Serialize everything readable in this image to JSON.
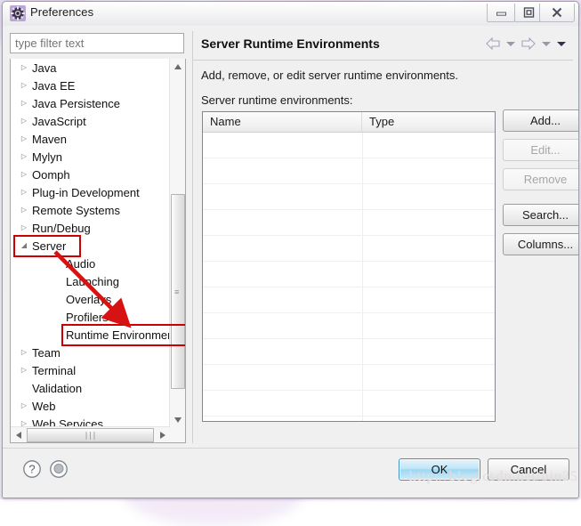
{
  "window": {
    "title": "Preferences",
    "icon": "gear-icon",
    "controls": {
      "minimize": "minimize-icon",
      "maximize": "maximize-icon",
      "close": "close-icon"
    }
  },
  "filter": {
    "value": "",
    "placeholder": "type filter text"
  },
  "tree": {
    "items": [
      {
        "label": "Java",
        "twisty": "▷",
        "level": 0,
        "expanded": false
      },
      {
        "label": "Java EE",
        "twisty": "▷",
        "level": 0,
        "expanded": false
      },
      {
        "label": "Java Persistence",
        "twisty": "▷",
        "level": 0,
        "expanded": false
      },
      {
        "label": "JavaScript",
        "twisty": "▷",
        "level": 0,
        "expanded": false
      },
      {
        "label": "Maven",
        "twisty": "▷",
        "level": 0,
        "expanded": false
      },
      {
        "label": "Mylyn",
        "twisty": "▷",
        "level": 0,
        "expanded": false
      },
      {
        "label": "Oomph",
        "twisty": "▷",
        "level": 0,
        "expanded": false
      },
      {
        "label": "Plug-in Development",
        "twisty": "▷",
        "level": 0,
        "expanded": false
      },
      {
        "label": "Remote Systems",
        "twisty": "▷",
        "level": 0,
        "expanded": false
      },
      {
        "label": "Run/Debug",
        "twisty": "▷",
        "level": 0,
        "expanded": false
      },
      {
        "label": "Server",
        "twisty": "◢",
        "level": 0,
        "expanded": true
      },
      {
        "label": "Audio",
        "twisty": "",
        "level": 1,
        "expanded": false
      },
      {
        "label": "Launching",
        "twisty": "",
        "level": 1,
        "expanded": false
      },
      {
        "label": "Overlays",
        "twisty": "",
        "level": 1,
        "expanded": false
      },
      {
        "label": "Profilers",
        "twisty": "",
        "level": 1,
        "expanded": false
      },
      {
        "label": "Runtime Environment",
        "twisty": "",
        "level": 1,
        "expanded": false
      },
      {
        "label": "Team",
        "twisty": "▷",
        "level": 0,
        "expanded": false
      },
      {
        "label": "Terminal",
        "twisty": "▷",
        "level": 0,
        "expanded": false
      },
      {
        "label": "Validation",
        "twisty": "",
        "level": 0,
        "expanded": false
      },
      {
        "label": "Web",
        "twisty": "▷",
        "level": 0,
        "expanded": false
      },
      {
        "label": "Web Services",
        "twisty": "▷",
        "level": 0,
        "expanded": false
      }
    ],
    "scroll_grip": "≡",
    "hscroll_grip": "∣∣∣",
    "arrow_up": "▲",
    "arrow_down": "▼",
    "arrow_left": "◀",
    "arrow_right": "▶"
  },
  "annotations": {
    "highlight_color": "#cc0000",
    "boxed_items": [
      "Server",
      "Runtime Environment"
    ],
    "arrow": "red-arrow-pointing-to-runtime-environment"
  },
  "pane": {
    "title": "Server Runtime Environments",
    "description": "Add, remove, or edit server runtime environments.",
    "sublabel": "Server runtime environments:",
    "nav": {
      "back": "back-arrow-icon",
      "back_menu": "chevron-down-icon",
      "forward": "forward-arrow-icon",
      "forward_menu": "chevron-down-icon",
      "view_menu": "chevron-down-icon"
    }
  },
  "table": {
    "columns": [
      "Name",
      "Type"
    ],
    "rows": [],
    "empty_row_count": 12
  },
  "side_buttons": [
    {
      "label": "Add...",
      "enabled": true
    },
    {
      "label": "Edit...",
      "enabled": false
    },
    {
      "label": "Remove",
      "enabled": false
    },
    {
      "label": "Search...",
      "enabled": true
    },
    {
      "label": "Columns...",
      "enabled": true
    }
  ],
  "footer": {
    "help_icon": "question-mark-icon",
    "secondary_icon": "circle-icon",
    "ok_label": "OK",
    "cancel_label": "Cancel"
  },
  "watermark": {
    "text": "http://blog.csdn.net/bin25"
  }
}
